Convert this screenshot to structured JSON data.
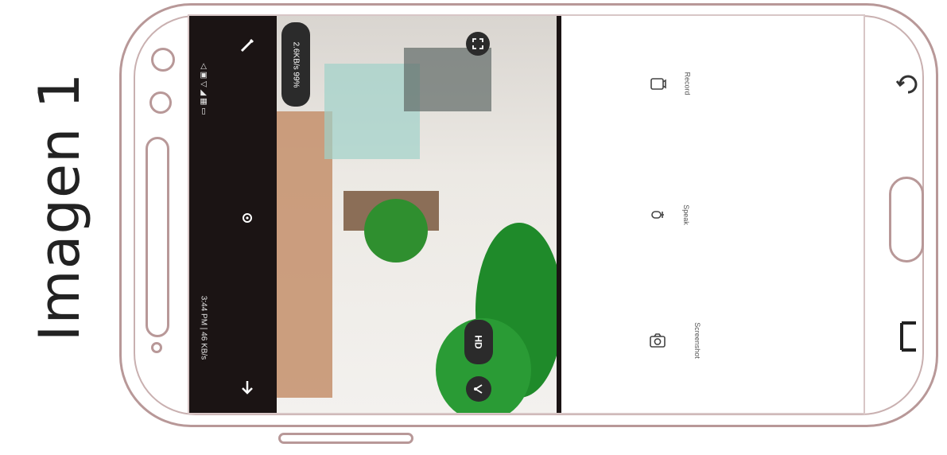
{
  "caption": "Imagen 1",
  "status_bar": {
    "time_info": "3:44 PM | 46 KB/s",
    "signal_info": "◁ ▣ ▽ ◢ ▦ ▭"
  },
  "camera_toolbar": {
    "speed_badge": "2.6KB/s 99%",
    "quality_badge": "HD"
  },
  "controls": {
    "screenshot_label": "Screenshot",
    "speak_label": "Speak",
    "record_label": "Record"
  },
  "icons": [
    "back-arrow-icon",
    "edit-icon",
    "eye-icon",
    "fullscreen-icon",
    "share-icon",
    "camera-icon",
    "mic-icon",
    "video-icon",
    "recent-apps-icon",
    "home-button",
    "back-nav-icon"
  ],
  "colors": {
    "frame": "#b89898",
    "topbar": "#1b1414",
    "plant": "#1f8a2a"
  }
}
